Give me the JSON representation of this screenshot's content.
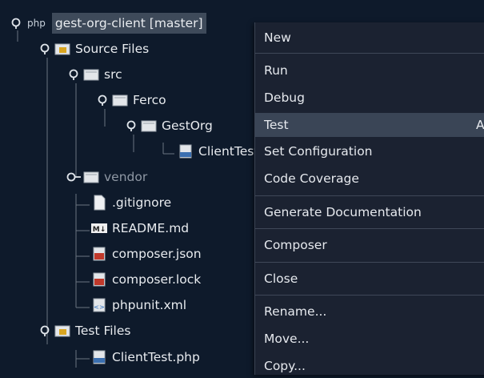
{
  "tree": {
    "root": {
      "badge": "php",
      "label": "gest-org-client [master]"
    },
    "items": [
      {
        "label": "Source Files"
      },
      {
        "label": "src"
      },
      {
        "label": "Ferco"
      },
      {
        "label": "GestOrg"
      },
      {
        "label": "ClientTest.php"
      },
      {
        "label": "vendor"
      },
      {
        "label": ".gitignore"
      },
      {
        "label": "README.md"
      },
      {
        "label": "composer.json"
      },
      {
        "label": "composer.lock"
      },
      {
        "label": "phpunit.xml"
      },
      {
        "label": "Test Files"
      },
      {
        "label": "ClientTest.php"
      }
    ]
  },
  "context_menu": {
    "items": [
      {
        "label": "New"
      },
      {
        "label": "Run"
      },
      {
        "label": "Debug"
      },
      {
        "label": "Test",
        "accelerator": "A"
      },
      {
        "label": "Set Configuration"
      },
      {
        "label": "Code Coverage"
      },
      {
        "label": "Generate Documentation"
      },
      {
        "label": "Composer"
      },
      {
        "label": "Close"
      },
      {
        "label": "Rename..."
      },
      {
        "label": "Move..."
      },
      {
        "label": "Copy..."
      }
    ]
  },
  "colors": {
    "background": "#0e1a2b",
    "menu_background": "#1b2231",
    "menu_highlight": "#3a4556",
    "folder_gold": "#d9a520"
  }
}
